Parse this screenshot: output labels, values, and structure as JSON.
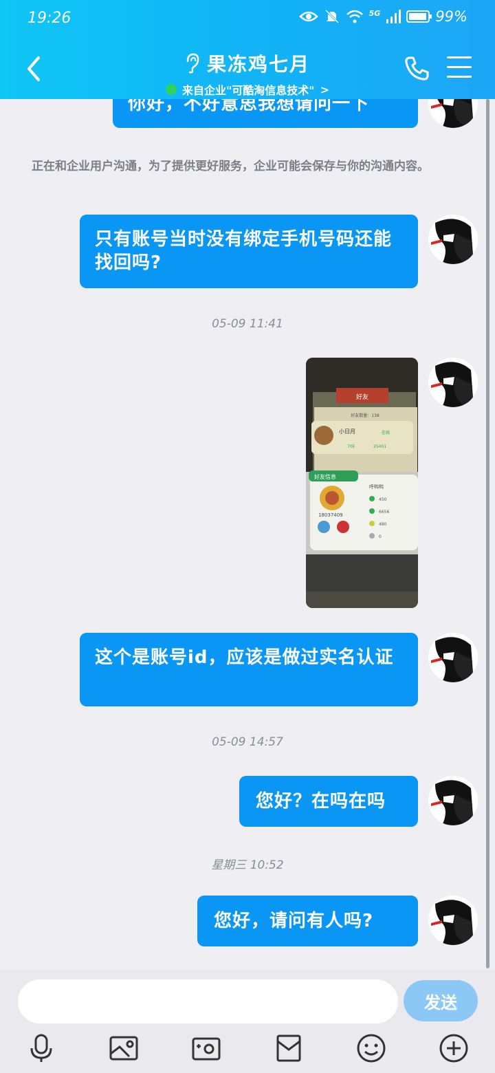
{
  "status_bar": {
    "time": "19:26",
    "network": "5G",
    "battery": "99%"
  },
  "header": {
    "title": "果冻鸡七月",
    "subtitle": "来自企业\"可酷淘信息技术\"",
    "subtitle_chevron": ">"
  },
  "messages": [
    {
      "type": "text",
      "text": "你好，不好意思我想请问一下"
    },
    {
      "type": "notice",
      "text": "正在和企业用户沟通，为了提供更好服务，企业可能会保存与你的沟通内容。"
    },
    {
      "type": "text",
      "text": "只有账号当时没有绑定手机号码还能找回吗?"
    },
    {
      "type": "timestamp",
      "text": "05-09 11:41"
    },
    {
      "type": "image",
      "text": ""
    },
    {
      "type": "text",
      "text": "这个是账号id，应该是做过实名认证"
    },
    {
      "type": "timestamp",
      "text": "05-09 14:57"
    },
    {
      "type": "text",
      "text": "您好？在吗在吗"
    },
    {
      "type": "timestamp",
      "text": "星期三 10:52"
    },
    {
      "type": "text",
      "text": "您好，请问有人吗?"
    }
  ],
  "photo": {
    "tab_label": "好友",
    "count_label": "好友数量：138",
    "friend_name": "小日月",
    "stat_a": "70E",
    "stat_b": "25401",
    "stat_c": "在线",
    "popup_title": "好友信息",
    "popup_name": "呼鸭鸭",
    "player_id": "18037409",
    "vals": [
      "450",
      "6656",
      "480",
      "0"
    ]
  },
  "input": {
    "value": "",
    "placeholder": "",
    "send_label": "发送"
  },
  "toolbar_icons": [
    "microphone-icon",
    "photo-album-icon",
    "camera-icon",
    "red-packet-icon",
    "emoji-icon",
    "plus-icon"
  ],
  "colors": {
    "header": "#12b2f7",
    "bubble": "#0a96f5",
    "send_disabled": "#8bc8f5"
  }
}
